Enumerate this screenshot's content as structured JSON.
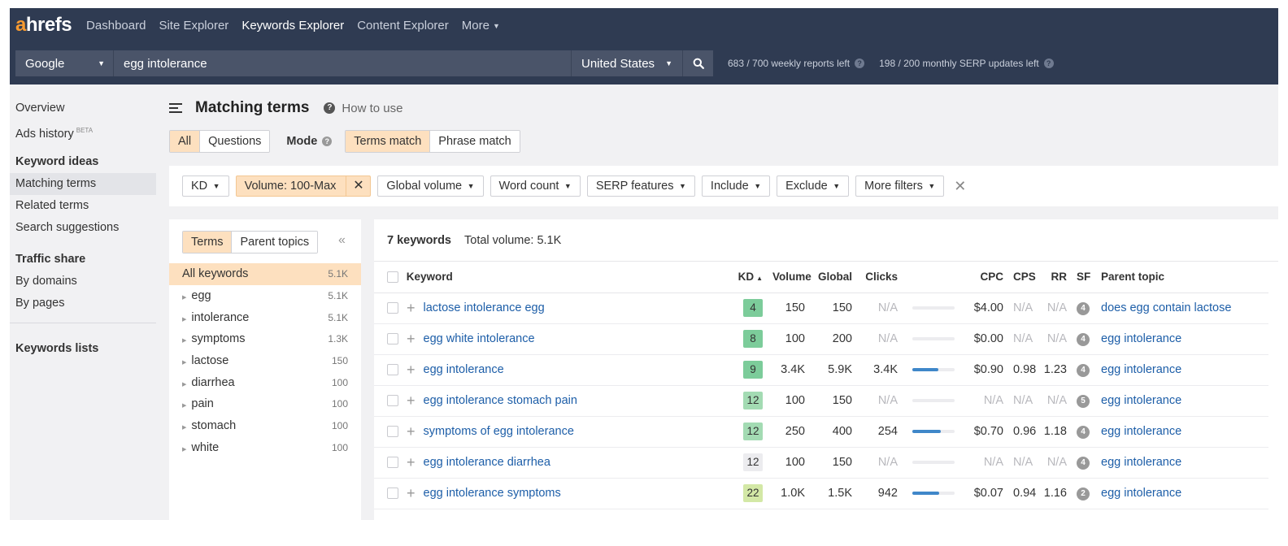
{
  "brand": {
    "logo_a": "a",
    "logo_rest": "hrefs"
  },
  "nav": {
    "items": [
      "Dashboard",
      "Site Explorer",
      "Keywords Explorer",
      "Content Explorer"
    ],
    "more": "More"
  },
  "search": {
    "engine": "Google",
    "query": "egg intolerance",
    "country": "United States",
    "weekly_quota": "683 / 700 weekly reports left",
    "monthly_quota": "198 / 200 monthly SERP updates left"
  },
  "sidebar": {
    "overview": "Overview",
    "ads_history": "Ads history",
    "beta": "BETA",
    "keyword_ideas_head": "Keyword ideas",
    "matching_terms": "Matching terms",
    "related_terms": "Related terms",
    "search_suggestions": "Search suggestions",
    "traffic_share_head": "Traffic share",
    "by_domains": "By domains",
    "by_pages": "By pages",
    "keywords_lists": "Keywords lists"
  },
  "page": {
    "title": "Matching terms",
    "how_to": "How to use",
    "tab_all": "All",
    "tab_questions": "Questions",
    "mode_label": "Mode",
    "mode_terms": "Terms match",
    "mode_phrase": "Phrase match"
  },
  "filters": {
    "kd": "KD",
    "volume": "Volume: 100-Max",
    "global_volume": "Global volume",
    "word_count": "Word count",
    "serp_features": "SERP features",
    "include": "Include",
    "exclude": "Exclude",
    "more_filters": "More filters"
  },
  "terms_panel": {
    "tab_terms": "Terms",
    "tab_parent": "Parent topics",
    "rows": [
      {
        "label": "All keywords",
        "count": "5.1K"
      },
      {
        "label": "egg",
        "count": "5.1K"
      },
      {
        "label": "intolerance",
        "count": "5.1K"
      },
      {
        "label": "symptoms",
        "count": "1.3K"
      },
      {
        "label": "lactose",
        "count": "150"
      },
      {
        "label": "diarrhea",
        "count": "100"
      },
      {
        "label": "pain",
        "count": "100"
      },
      {
        "label": "stomach",
        "count": "100"
      },
      {
        "label": "white",
        "count": "100"
      }
    ]
  },
  "results": {
    "count_label": "7 keywords",
    "total_volume": "Total volume: 5.1K",
    "headers": {
      "keyword": "Keyword",
      "kd": "KD",
      "volume": "Volume",
      "global": "Global",
      "clicks": "Clicks",
      "cpc": "CPC",
      "cps": "CPS",
      "rr": "RR",
      "sf": "SF",
      "parent": "Parent topic"
    },
    "rows": [
      {
        "keyword": "lactose intolerance egg",
        "kd": "4",
        "kd_color": "#7ccc9a",
        "volume": "150",
        "global": "150",
        "clicks": "N/A",
        "clicks_fill": 0,
        "cpc": "$4.00",
        "cps": "N/A",
        "rr": "N/A",
        "sf": "4",
        "parent": "does egg contain lactose"
      },
      {
        "keyword": "egg white intolerance",
        "kd": "8",
        "kd_color": "#7ccc9a",
        "volume": "100",
        "global": "200",
        "clicks": "N/A",
        "clicks_fill": 0,
        "cpc": "$0.00",
        "cps": "N/A",
        "rr": "N/A",
        "sf": "4",
        "parent": "egg intolerance"
      },
      {
        "keyword": "egg intolerance",
        "kd": "9",
        "kd_color": "#7ccc9a",
        "volume": "3.4K",
        "global": "5.9K",
        "clicks": "3.4K",
        "clicks_fill": 0.62,
        "cpc": "$0.90",
        "cps": "0.98",
        "rr": "1.23",
        "sf": "4",
        "parent": "egg intolerance"
      },
      {
        "keyword": "egg intolerance stomach pain",
        "kd": "12",
        "kd_color": "#a3dbb3",
        "volume": "100",
        "global": "150",
        "clicks": "N/A",
        "clicks_fill": 0,
        "cpc": "N/A",
        "cps": "N/A",
        "rr": "N/A",
        "sf": "5",
        "parent": "egg intolerance"
      },
      {
        "keyword": "symptoms of egg intolerance",
        "kd": "12",
        "kd_color": "#a3dbb3",
        "volume": "250",
        "global": "400",
        "clicks": "254",
        "clicks_fill": 0.68,
        "cpc": "$0.70",
        "cps": "0.96",
        "rr": "1.18",
        "sf": "4",
        "parent": "egg intolerance"
      },
      {
        "keyword": "egg intolerance diarrhea",
        "kd": "12",
        "kd_color": "#ececef",
        "volume": "100",
        "global": "150",
        "clicks": "N/A",
        "clicks_fill": 0,
        "cpc": "N/A",
        "cps": "N/A",
        "rr": "N/A",
        "sf": "4",
        "parent": "egg intolerance"
      },
      {
        "keyword": "egg intolerance symptoms",
        "kd": "22",
        "kd_color": "#d3e8a6",
        "volume": "1.0K",
        "global": "1.5K",
        "clicks": "942",
        "clicks_fill": 0.64,
        "cpc": "$0.07",
        "cps": "0.94",
        "rr": "1.16",
        "sf": "2",
        "parent": "egg intolerance"
      }
    ]
  }
}
